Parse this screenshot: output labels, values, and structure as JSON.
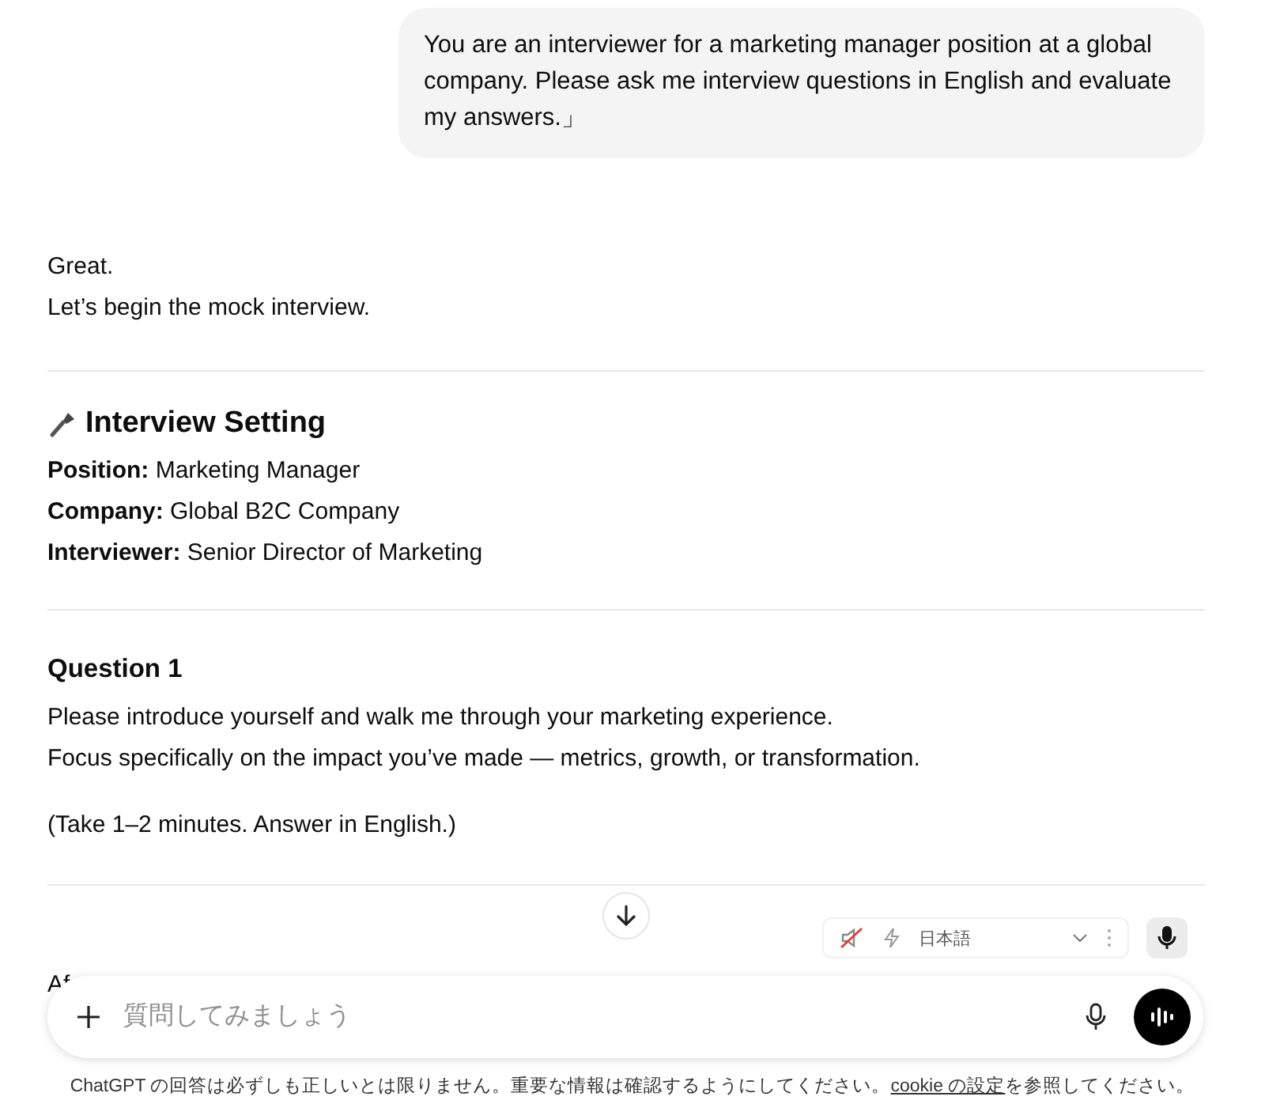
{
  "user_message": "You are an interviewer for a marketing manager position at a global company. Please ask me interview questions in English and evaluate my answers.」",
  "intro": [
    "Great.",
    "Let’s begin the mock interview."
  ],
  "setting": {
    "title": "Interview Setting",
    "fields": [
      {
        "label": "Position:",
        "value": "Marketing Manager"
      },
      {
        "label": "Company:",
        "value": "Global B2C Company"
      },
      {
        "label": "Interviewer:",
        "value": "Senior Director of Marketing"
      }
    ]
  },
  "question": {
    "title": "Question 1",
    "lines": [
      "Please introduce yourself and walk me through your marketing experience.",
      "Focus specifically on the impact you’ve made — metrics, growth, or transformation."
    ],
    "note": "(Take 1–2 minutes. Answer in English.)"
  },
  "cut_text": "Af",
  "voice_bar": {
    "language": "日本語",
    "muted": true
  },
  "composer": {
    "placeholder": "質問してみましょう"
  },
  "footer": {
    "before": "ChatGPT の回答は必ずしも正しいとは限りません。重要な情報は確認するようにしてください。",
    "link": "cookie の設定",
    "after": "を参照してください。"
  }
}
